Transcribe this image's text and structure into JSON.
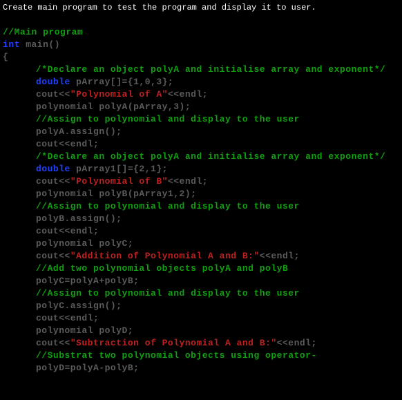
{
  "instruction": "Create main program to test the program and display it to user.",
  "lines": {
    "l1": "//Main program",
    "l2a": "int",
    "l2b": " main()",
    "l3": "{",
    "l4": "/*Declare an object polyA and initialise array and exponent*/",
    "l5a": "double",
    "l5b": " pArray[]={1,0,3};",
    "l6a": "cout<<",
    "l6b": "\"Polynomial of A\"",
    "l6c": "<<endl;",
    "l7": "polynomial polyA(pArray,3);",
    "l8": "//Assign to polynomial and display to the user",
    "l9": "polyA.assign();",
    "l10": "cout<<endl;",
    "l11": "/*Declare an object polyA and initialise array and exponent*/",
    "l12a": "double",
    "l12b": " pArray1[]={2,1};",
    "l13a": "cout<<",
    "l13b": "\"Polynomial of B\"",
    "l13c": "<<endl;",
    "l14": "polynomial polyB(pArray1,2);",
    "l15": "//Assign to polynomial and display to the user",
    "l16": "polyB.assign();",
    "l17": "cout<<endl;",
    "l18": "polynomial polyC;",
    "l19a": "cout<<",
    "l19b": "\"Addition of Polynomial A and B:\"",
    "l19c": "<<endl;",
    "l20": "//Add two polynomial objects polyA and polyB",
    "l21": "polyC=polyA+polyB;",
    "l22": "//Assign to polynomial and display to the user",
    "l23": "polyC.assign();",
    "l24": "cout<<endl;",
    "l25": "polynomial polyD;",
    "l26a": "cout<<",
    "l26b": "\"Subtraction of Polynomial A and B:\"",
    "l26c": "<<endl;",
    "l27": "//Substrat two polynomial objects using operator-",
    "l28": "polyD=polyA-polyB;"
  }
}
